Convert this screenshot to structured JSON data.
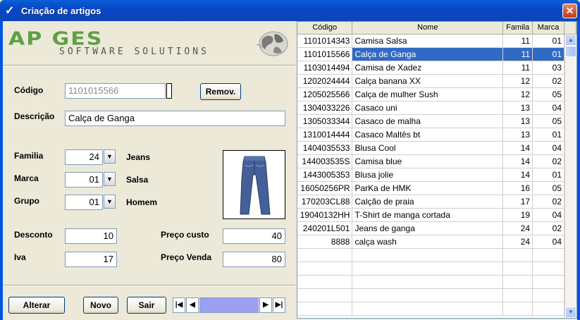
{
  "window": {
    "title": "Criação de artigos",
    "close_glyph": "✕",
    "check_glyph": "✓"
  },
  "logo": {
    "main": "AP GES",
    "sub": "SOFTWARE SOLUTIONS"
  },
  "form": {
    "codigo_label": "Código",
    "codigo_value": "1101015566",
    "remove_button": "Remov.",
    "descricao_label": "Descrição",
    "descricao_value": "Calça de Ganga",
    "familia_label": "Familia",
    "familia_value": "24",
    "familia_name": "Jeans",
    "marca_label": "Marca",
    "marca_value": "01",
    "marca_name": "Salsa",
    "grupo_label": "Grupo",
    "grupo_value": "01",
    "grupo_name": "Homem",
    "desconto_label": "Desconto",
    "desconto_value": "10",
    "iva_label": "Iva",
    "iva_value": "17",
    "preco_custo_label": "Preço custo",
    "preco_custo_value": "40",
    "preco_venda_label": "Preço Venda",
    "preco_venda_value": "80"
  },
  "buttons": {
    "alterar": "Alterar",
    "novo": "Novo",
    "sair": "Sair"
  },
  "nav": {
    "first": "|◀",
    "prev": "◀",
    "next": "▶",
    "last": "▶|"
  },
  "grid": {
    "columns": [
      "Código",
      "Nome",
      "Famila",
      "Marca"
    ],
    "selected_index": 1,
    "rows": [
      [
        "1101014343",
        "Camisa Salsa",
        "11",
        "01"
      ],
      [
        "1101015566",
        "Calça de Ganga",
        "11",
        "01"
      ],
      [
        "1103014494",
        "Camisa de Xadez",
        "11",
        "03"
      ],
      [
        "1202024444",
        "Calça banana XX",
        "12",
        "02"
      ],
      [
        "1205025566",
        "Calça de mulher Sush",
        "12",
        "05"
      ],
      [
        "1304033226",
        "Casaco uni",
        "13",
        "04"
      ],
      [
        "1305033344",
        "Casaco de malha",
        "13",
        "05"
      ],
      [
        "1310014444",
        "Casaco Maltês bt",
        "13",
        "01"
      ],
      [
        "1404035533",
        "Blusa Cool",
        "14",
        "04"
      ],
      [
        "144003535S",
        "Camisa blue",
        "14",
        "02"
      ],
      [
        "1443005353",
        "Blusa jolie",
        "14",
        "01"
      ],
      [
        "16050256PR",
        "ParKa de HMK",
        "16",
        "05"
      ],
      [
        "170203CL88",
        "Calção de praia",
        "17",
        "02"
      ],
      [
        "19040132HH",
        "T-Shirt de manga cortada",
        "19",
        "04"
      ],
      [
        "240201L501",
        "Jeans de ganga",
        "24",
        "02"
      ],
      [
        "8888",
        "calça wash",
        "24",
        "04"
      ]
    ],
    "empty_rows": 5
  },
  "colors": {
    "selection": "#316ac5",
    "titlebar": "#0848c6",
    "logo_green": "#5fa043"
  }
}
